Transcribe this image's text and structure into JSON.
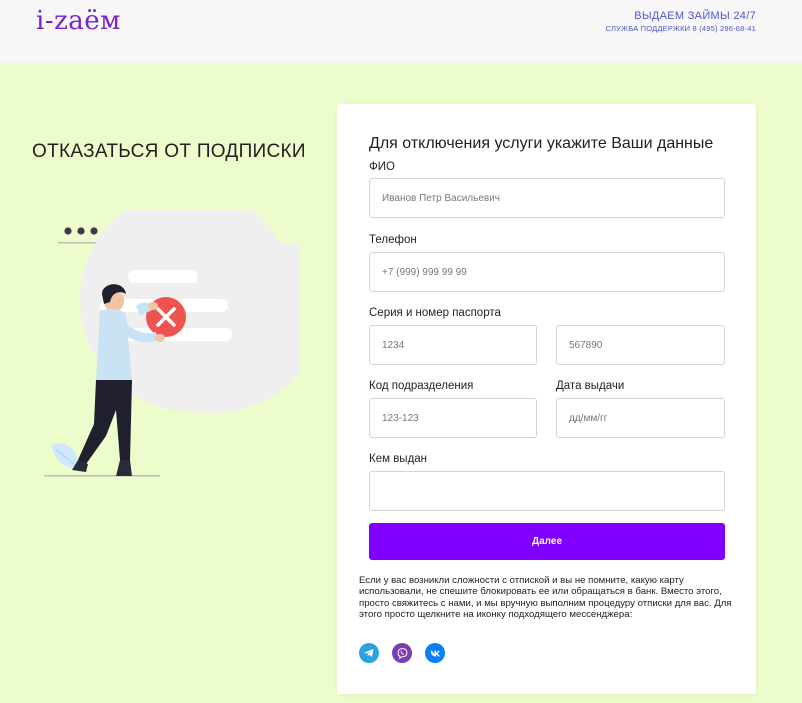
{
  "header": {
    "logo": "i-zaём",
    "tagline": "ВЫДАЕМ ЗАЙМЫ 24/7",
    "support": "СЛУЖБА ПОДДЕРЖКИ 8 (495) 296-68-41"
  },
  "page": {
    "title": "ОТКАЗАТЬСЯ ОТ ПОДПИСКИ"
  },
  "form": {
    "title": "Для отключения услуги укажите Ваши данные",
    "fio": {
      "label": "ФИО",
      "placeholder": "Иванов Петр Васильевич",
      "value": ""
    },
    "phone": {
      "label": "Телефон",
      "placeholder": "+7 (999) 999 99 99",
      "value": ""
    },
    "passport": {
      "label": "Серия и номер паспорта",
      "series_placeholder": "1234",
      "number_placeholder": "567890"
    },
    "division_code": {
      "label": "Код подразделения",
      "placeholder": "123-123"
    },
    "issue_date": {
      "label": "Дата выдачи",
      "placeholder": "дд/мм/гг"
    },
    "issued_by": {
      "label": "Кем выдан",
      "placeholder": "",
      "value": ""
    },
    "submit_label": "Далее",
    "help_text": "Если у вас возникли сложности с отпиской и вы не помните, какую карту использовали, не спешите блокировать ее или обращаться в банк. Вместо этого, просто свяжитесь с нами, и мы вручную выполним процедуру отписки для вас. Для этого просто щелкните на иконку подходящего мессенджера:"
  },
  "socials": [
    {
      "icon": "telegram-icon",
      "color": "#2aa3e0"
    },
    {
      "icon": "viber-icon",
      "color": "#7d3daf"
    },
    {
      "icon": "vk-icon",
      "color": "#0a7ff5"
    }
  ],
  "colors": {
    "accent": "#7f00ff",
    "background": "#ecfccb",
    "logo": "#7c22c9",
    "header_text": "#4f57c9"
  }
}
